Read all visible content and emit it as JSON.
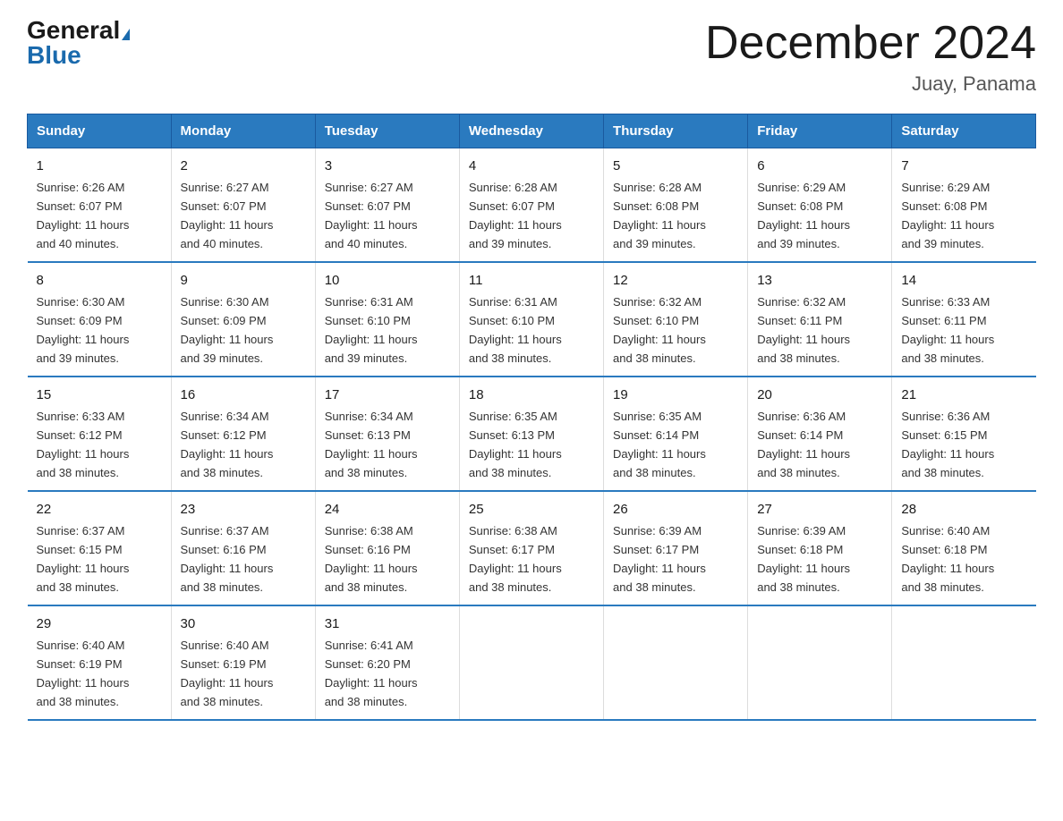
{
  "logo": {
    "general": "General",
    "blue": "Blue",
    "triangle": "▶"
  },
  "title": "December 2024",
  "subtitle": "Juay, Panama",
  "days": [
    "Sunday",
    "Monday",
    "Tuesday",
    "Wednesday",
    "Thursday",
    "Friday",
    "Saturday"
  ],
  "weeks": [
    [
      {
        "day": "1",
        "sunrise": "6:26 AM",
        "sunset": "6:07 PM",
        "daylight": "11 hours and 40 minutes."
      },
      {
        "day": "2",
        "sunrise": "6:27 AM",
        "sunset": "6:07 PM",
        "daylight": "11 hours and 40 minutes."
      },
      {
        "day": "3",
        "sunrise": "6:27 AM",
        "sunset": "6:07 PM",
        "daylight": "11 hours and 40 minutes."
      },
      {
        "day": "4",
        "sunrise": "6:28 AM",
        "sunset": "6:07 PM",
        "daylight": "11 hours and 39 minutes."
      },
      {
        "day": "5",
        "sunrise": "6:28 AM",
        "sunset": "6:08 PM",
        "daylight": "11 hours and 39 minutes."
      },
      {
        "day": "6",
        "sunrise": "6:29 AM",
        "sunset": "6:08 PM",
        "daylight": "11 hours and 39 minutes."
      },
      {
        "day": "7",
        "sunrise": "6:29 AM",
        "sunset": "6:08 PM",
        "daylight": "11 hours and 39 minutes."
      }
    ],
    [
      {
        "day": "8",
        "sunrise": "6:30 AM",
        "sunset": "6:09 PM",
        "daylight": "11 hours and 39 minutes."
      },
      {
        "day": "9",
        "sunrise": "6:30 AM",
        "sunset": "6:09 PM",
        "daylight": "11 hours and 39 minutes."
      },
      {
        "day": "10",
        "sunrise": "6:31 AM",
        "sunset": "6:10 PM",
        "daylight": "11 hours and 39 minutes."
      },
      {
        "day": "11",
        "sunrise": "6:31 AM",
        "sunset": "6:10 PM",
        "daylight": "11 hours and 38 minutes."
      },
      {
        "day": "12",
        "sunrise": "6:32 AM",
        "sunset": "6:10 PM",
        "daylight": "11 hours and 38 minutes."
      },
      {
        "day": "13",
        "sunrise": "6:32 AM",
        "sunset": "6:11 PM",
        "daylight": "11 hours and 38 minutes."
      },
      {
        "day": "14",
        "sunrise": "6:33 AM",
        "sunset": "6:11 PM",
        "daylight": "11 hours and 38 minutes."
      }
    ],
    [
      {
        "day": "15",
        "sunrise": "6:33 AM",
        "sunset": "6:12 PM",
        "daylight": "11 hours and 38 minutes."
      },
      {
        "day": "16",
        "sunrise": "6:34 AM",
        "sunset": "6:12 PM",
        "daylight": "11 hours and 38 minutes."
      },
      {
        "day": "17",
        "sunrise": "6:34 AM",
        "sunset": "6:13 PM",
        "daylight": "11 hours and 38 minutes."
      },
      {
        "day": "18",
        "sunrise": "6:35 AM",
        "sunset": "6:13 PM",
        "daylight": "11 hours and 38 minutes."
      },
      {
        "day": "19",
        "sunrise": "6:35 AM",
        "sunset": "6:14 PM",
        "daylight": "11 hours and 38 minutes."
      },
      {
        "day": "20",
        "sunrise": "6:36 AM",
        "sunset": "6:14 PM",
        "daylight": "11 hours and 38 minutes."
      },
      {
        "day": "21",
        "sunrise": "6:36 AM",
        "sunset": "6:15 PM",
        "daylight": "11 hours and 38 minutes."
      }
    ],
    [
      {
        "day": "22",
        "sunrise": "6:37 AM",
        "sunset": "6:15 PM",
        "daylight": "11 hours and 38 minutes."
      },
      {
        "day": "23",
        "sunrise": "6:37 AM",
        "sunset": "6:16 PM",
        "daylight": "11 hours and 38 minutes."
      },
      {
        "day": "24",
        "sunrise": "6:38 AM",
        "sunset": "6:16 PM",
        "daylight": "11 hours and 38 minutes."
      },
      {
        "day": "25",
        "sunrise": "6:38 AM",
        "sunset": "6:17 PM",
        "daylight": "11 hours and 38 minutes."
      },
      {
        "day": "26",
        "sunrise": "6:39 AM",
        "sunset": "6:17 PM",
        "daylight": "11 hours and 38 minutes."
      },
      {
        "day": "27",
        "sunrise": "6:39 AM",
        "sunset": "6:18 PM",
        "daylight": "11 hours and 38 minutes."
      },
      {
        "day": "28",
        "sunrise": "6:40 AM",
        "sunset": "6:18 PM",
        "daylight": "11 hours and 38 minutes."
      }
    ],
    [
      {
        "day": "29",
        "sunrise": "6:40 AM",
        "sunset": "6:19 PM",
        "daylight": "11 hours and 38 minutes."
      },
      {
        "day": "30",
        "sunrise": "6:40 AM",
        "sunset": "6:19 PM",
        "daylight": "11 hours and 38 minutes."
      },
      {
        "day": "31",
        "sunrise": "6:41 AM",
        "sunset": "6:20 PM",
        "daylight": "11 hours and 38 minutes."
      },
      null,
      null,
      null,
      null
    ]
  ],
  "labels": {
    "sunrise": "Sunrise:",
    "sunset": "Sunset:",
    "daylight": "Daylight:"
  }
}
